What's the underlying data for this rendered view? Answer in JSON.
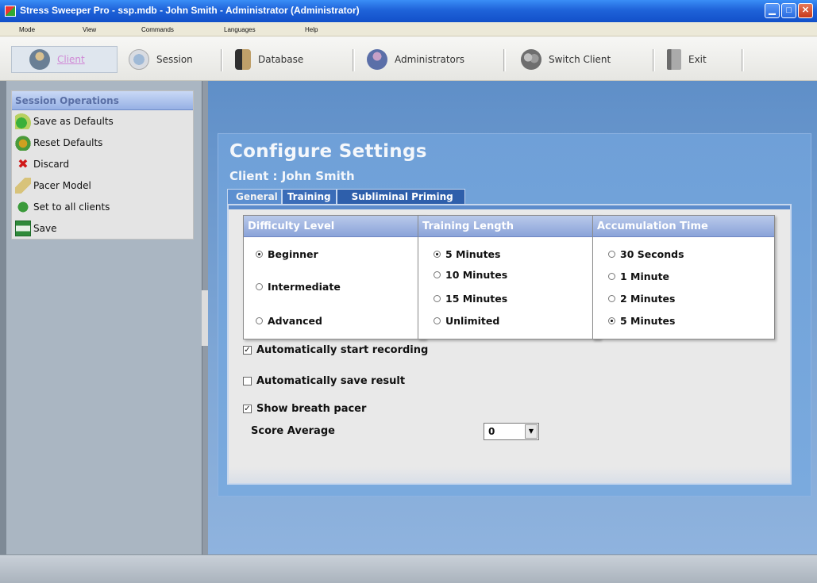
{
  "window": {
    "title": "Stress Sweeper Pro - ssp.mdb - John Smith - Administrator  (Administrator)",
    "min_glyph": "▁",
    "max_glyph": "□",
    "close_glyph": "✕"
  },
  "menu": {
    "items": [
      "Mode",
      "View",
      "Commands",
      "Languages",
      "Help"
    ]
  },
  "toolbar": {
    "items": [
      {
        "label": "Client",
        "icon": "client-icon"
      },
      {
        "label": "Session",
        "icon": "session-icon"
      },
      {
        "label": "Database",
        "icon": "database-icon"
      },
      {
        "label": "Administrators",
        "icon": "administrators-icon"
      },
      {
        "label": "Switch Client",
        "icon": "switch-client-icon"
      },
      {
        "label": "Exit",
        "icon": "exit-icon"
      }
    ]
  },
  "sidebar": {
    "header": "Session Operations",
    "items": [
      {
        "label": "Save as Defaults",
        "icon": "save-defaults-icon"
      },
      {
        "label": "Reset Defaults",
        "icon": "reset-defaults-icon"
      },
      {
        "label": "Discard",
        "icon": "discard-icon",
        "glyph": "✖"
      },
      {
        "label": "Pacer Model",
        "icon": "pacer-model-icon"
      },
      {
        "label": "Set to all clients",
        "icon": "set-all-clients-icon"
      },
      {
        "label": "Save",
        "icon": "save-icon"
      }
    ]
  },
  "config": {
    "title": "Configure Settings",
    "client_line": "Client : John Smith",
    "tabs": [
      "General",
      "Training",
      "Subliminal Priming"
    ],
    "active_tab": "General",
    "difficulty": {
      "header": "Difficulty Level",
      "options": [
        "Beginner",
        "Intermediate",
        "Advanced"
      ],
      "selected": "Beginner"
    },
    "training_length": {
      "header": "Training Length",
      "options": [
        "5 Minutes",
        "10 Minutes",
        "15 Minutes",
        "Unlimited"
      ],
      "selected": "5 Minutes"
    },
    "accumulation_time": {
      "header": "Accumulation Time",
      "options": [
        "30 Seconds",
        "1 Minute",
        "2 Minutes",
        "5 Minutes"
      ],
      "selected": "5 Minutes"
    },
    "checkboxes": [
      {
        "label": "Automatically start recording",
        "checked": true
      },
      {
        "label": "Automatically save result",
        "checked": false
      },
      {
        "label": "Show breath pacer",
        "checked": true
      }
    ],
    "check_glyph": "✓",
    "score_average": {
      "label": "Score Average",
      "value": "0",
      "arrow": "▼"
    }
  }
}
